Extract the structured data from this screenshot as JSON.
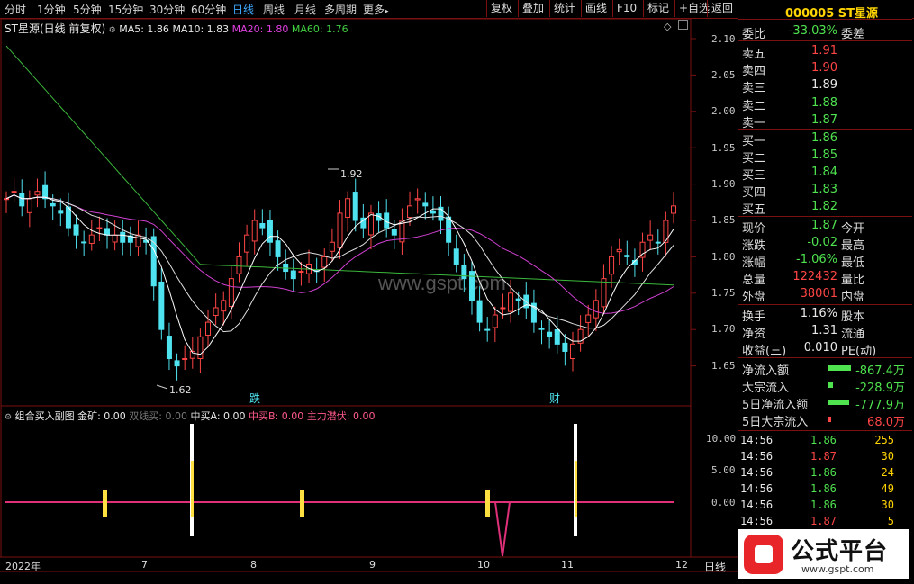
{
  "toolbar": {
    "periods": [
      "分时",
      "1分钟",
      "5分钟",
      "15分钟",
      "30分钟",
      "60分钟",
      "日线",
      "周线",
      "月线",
      "多周期",
      "更多"
    ],
    "more_arrow": "▸",
    "right_buttons": [
      "复权",
      "叠加",
      "统计",
      "画线",
      "F10",
      "标记",
      "+自选",
      "返回"
    ]
  },
  "main_chart": {
    "title": "ST星源(日线 前复权)",
    "ma5": "MA5: 1.86",
    "ma10": "MA10: 1.83",
    "ma20": "MA20: 1.80",
    "ma60": "MA60: 1.76",
    "high_label": "1.92",
    "low_label": "1.62",
    "marker_die": "跌",
    "marker_cai": "财",
    "y_ticks": [
      "2.10",
      "2.05",
      "2.00",
      "1.95",
      "1.90",
      "1.85",
      "1.80",
      "1.75",
      "1.70",
      "1.65"
    ],
    "watermark": "www.gspt.com",
    "colors": {
      "up": "#ff4545",
      "down": "#4fe3f0",
      "ma5": "#ffffff",
      "ma10": "#ffffff",
      "ma20": "#e040e0",
      "ma60": "#40c040"
    }
  },
  "sub_chart": {
    "title": "组合买入副图",
    "jinkuang": "金矿: 0.00",
    "shuangxian": "双线买: 0.00",
    "zhongmai_a": "中买A: 0.00",
    "zhongmai_b": "中买B: 0.00",
    "zhuli": "主力潜伏: 0.00",
    "y_ticks": [
      "10.00",
      "5.00",
      "0.00"
    ]
  },
  "x_axis": {
    "labels": [
      "2022年",
      "7",
      "8",
      "9",
      "10",
      "11",
      "12"
    ],
    "period_label": "日线"
  },
  "quote": {
    "code_name": "000005 ST星源",
    "weibi_label": "委比",
    "weibi": "-33.03%",
    "weicha_label": "委差",
    "asks": [
      {
        "l": "卖五",
        "p": "1.91"
      },
      {
        "l": "卖四",
        "p": "1.90"
      },
      {
        "l": "卖三",
        "p": "1.89"
      },
      {
        "l": "卖二",
        "p": "1.88"
      },
      {
        "l": "卖一",
        "p": "1.87"
      }
    ],
    "bids": [
      {
        "l": "买一",
        "p": "1.86"
      },
      {
        "l": "买二",
        "p": "1.85"
      },
      {
        "l": "买三",
        "p": "1.84"
      },
      {
        "l": "买四",
        "p": "1.83"
      },
      {
        "l": "买五",
        "p": "1.82"
      }
    ],
    "stats": [
      {
        "l": "现价",
        "v": "1.87",
        "r": "今开"
      },
      {
        "l": "涨跌",
        "v": "-0.02",
        "r": "最高"
      },
      {
        "l": "涨幅",
        "v": "-1.06%",
        "r": "最低"
      },
      {
        "l": "总量",
        "v": "122432",
        "r": "量比"
      },
      {
        "l": "外盘",
        "v": "38001",
        "r": "内盘"
      }
    ],
    "stats2": [
      {
        "l": "换手",
        "v": "1.16%",
        "r": "股本"
      },
      {
        "l": "净资",
        "v": "1.31",
        "r": "流通"
      },
      {
        "l": "收益(三)",
        "v": "0.010",
        "r": "PE(动)"
      }
    ],
    "flows": [
      {
        "l": "净流入额",
        "v": "-867.4万",
        "bar": 0.55
      },
      {
        "l": "大宗流入",
        "v": "-228.9万",
        "bar": 0.1
      },
      {
        "l": "5日净流入额",
        "v": "-777.9万",
        "bar": 0.5
      },
      {
        "l": "5日大宗流入",
        "v": "68.0万",
        "bar": 0.05
      }
    ],
    "ticks": [
      {
        "t": "14:56",
        "p": "1.86",
        "v": "255"
      },
      {
        "t": "14:56",
        "p": "1.87",
        "v": "30"
      },
      {
        "t": "14:56",
        "p": "1.86",
        "v": "24"
      },
      {
        "t": "14:56",
        "p": "1.86",
        "v": "49"
      },
      {
        "t": "14:56",
        "p": "1.86",
        "v": "30"
      },
      {
        "t": "14:56",
        "p": "1.87",
        "v": "5"
      }
    ]
  },
  "logo": {
    "text": "公式平台",
    "url": "www.gspt.com"
  }
}
